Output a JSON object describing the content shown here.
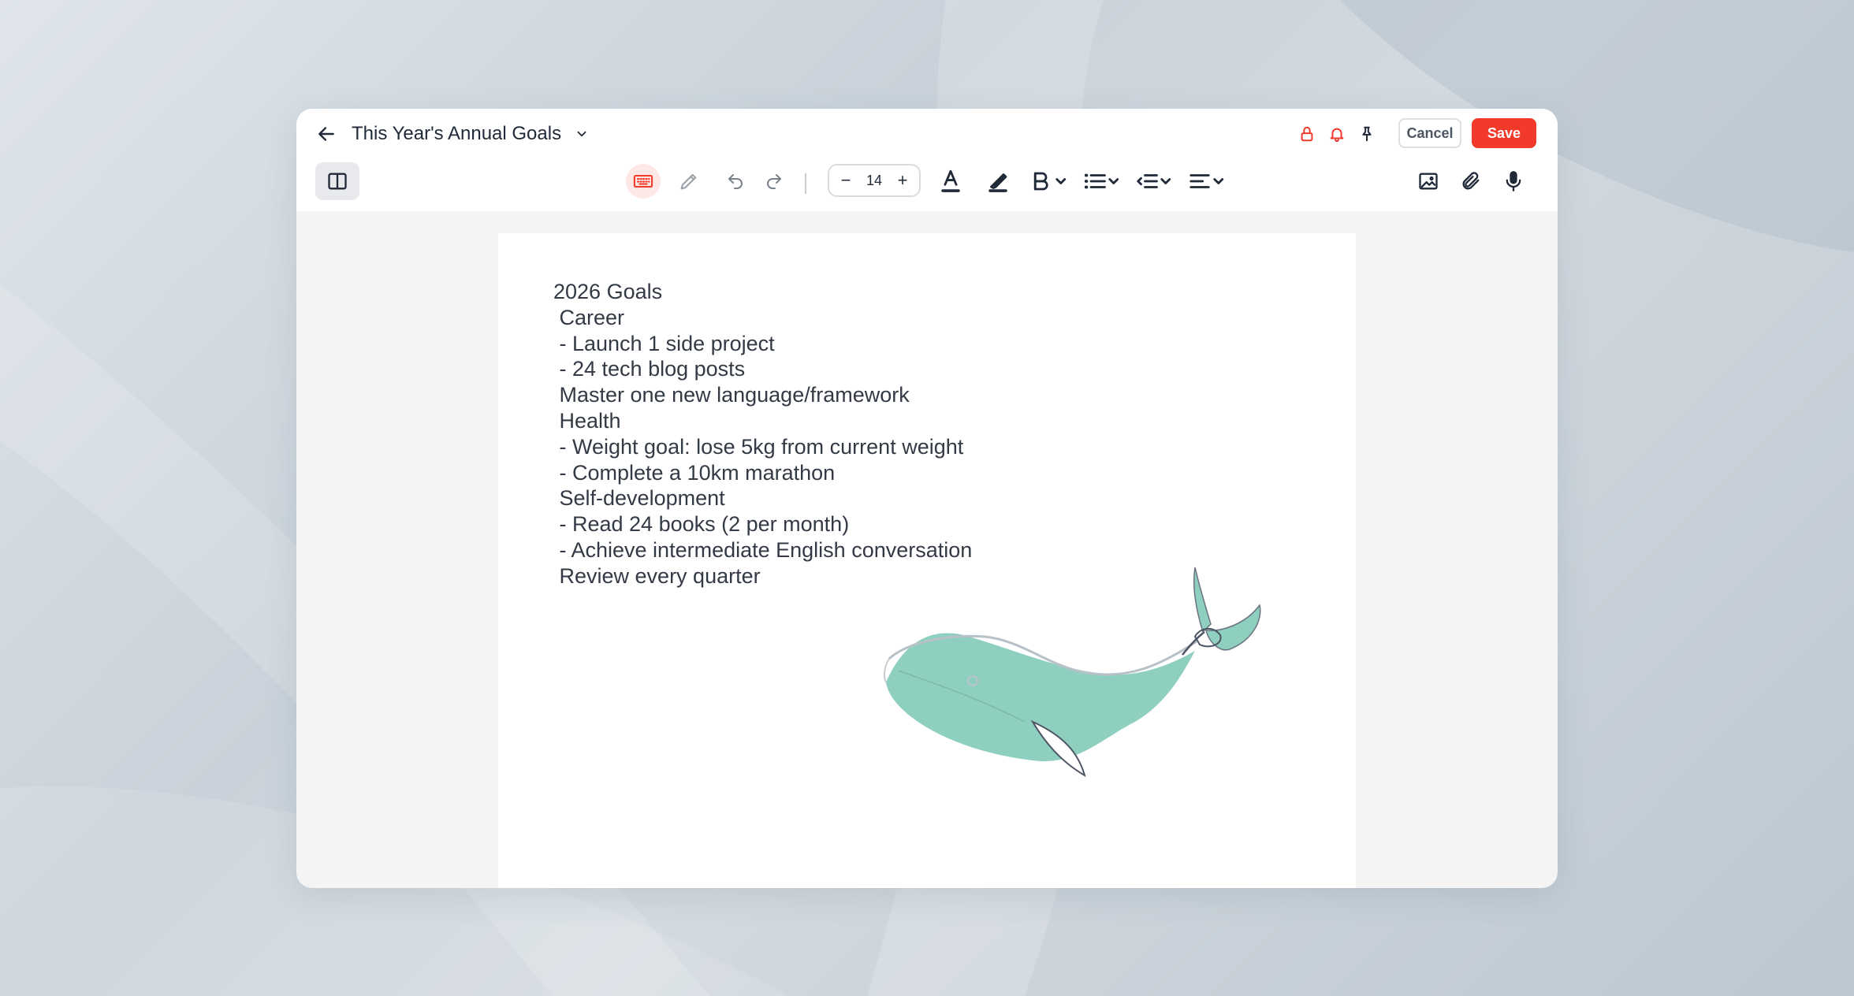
{
  "header": {
    "title": "This Year's Annual Goals",
    "cancel_label": "Cancel",
    "save_label": "Save"
  },
  "toolbar": {
    "font_size": "14"
  },
  "document": {
    "lines": [
      "2026 Goals",
      " Career",
      " - Launch 1 side project",
      " - 24 tech blog posts",
      " Master one new language/framework",
      " Health",
      " - Weight goal: lose 5kg from current weight",
      " - Complete a 10km marathon",
      " Self-development",
      " - Read 24 books (2 per month)",
      " - Achieve intermediate English conversation",
      " Review every quarter"
    ]
  },
  "icons": {
    "back": "arrow-left-icon",
    "title_dropdown": "chevron-down-icon",
    "lock": "lock-icon",
    "bell": "bell-icon",
    "pin": "pin-icon",
    "sidebar": "sidebar-toggle-icon",
    "keyboard": "keyboard-icon",
    "pencil": "pencil-icon",
    "undo": "undo-icon",
    "redo": "redo-icon",
    "text_color": "text-color-icon",
    "highlight": "highlighter-icon",
    "bold": "bold-icon",
    "list": "bullet-list-icon",
    "indent": "indent-icon",
    "align": "align-icon",
    "image": "image-icon",
    "attach": "paperclip-icon",
    "mic": "microphone-icon",
    "sticker": "whale-sticker"
  },
  "colors": {
    "accent": "#f13a2a",
    "whale_body": "#8ecfbf",
    "text": "#333a45"
  }
}
